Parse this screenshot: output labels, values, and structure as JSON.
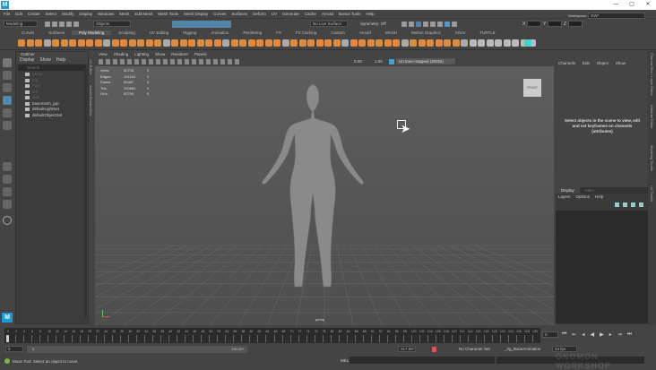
{
  "app": {
    "icon_letter": "M"
  },
  "window_controls": {
    "minimize": "—",
    "maximize": "▢",
    "close": "✕"
  },
  "menu": [
    "File",
    "Edit",
    "Create",
    "Select",
    "Modify",
    "Display",
    "Windows",
    "Mesh",
    "Edit Mesh",
    "Mesh Tools",
    "Mesh Display",
    "Curves",
    "Surfaces",
    "Deform",
    "UV",
    "Generate",
    "Cache",
    "Arnold",
    "Bonus Tools",
    "Help"
  ],
  "status": {
    "mode": "Modeling",
    "select_mode": "Objects",
    "live_surface": "No Live Surface",
    "symmetry": "Symmetry: Off",
    "workspace_label": "Workspace:",
    "workspace": "GW*",
    "x": "X",
    "y": "Y",
    "z": "Z"
  },
  "shelf_tabs": [
    "Curves",
    "Surfaces",
    "Poly Modeling",
    "Sculpting",
    "UV Editing",
    "Rigging",
    "Animation",
    "Rendering",
    "FX",
    "FX Caching",
    "Custom",
    "Arnold",
    "MASH",
    "Motion Graphics",
    "XGen",
    "TURTLE"
  ],
  "shelf_active": "Poly Modeling",
  "outliner": {
    "title": "Outliner",
    "menu": [
      "Display",
      "Show",
      "Help"
    ],
    "search_placeholder": "Search...",
    "items": [
      {
        "name": "persp",
        "dim": true
      },
      {
        "name": "top",
        "dim": true
      },
      {
        "name": "front",
        "dim": true
      },
      {
        "name": "left",
        "dim": true
      },
      {
        "name": "side",
        "dim": true
      },
      {
        "name": "basemesh_grp",
        "dim": false
      },
      {
        "name": "defaultLightSet",
        "dim": false
      },
      {
        "name": "defaultObjectSet",
        "dim": false
      }
    ]
  },
  "side_tabs": {
    "uv": "UV Editor",
    "arnold": "Arnold RenderView"
  },
  "viewport": {
    "menu": [
      "View",
      "Shading",
      "Lighting",
      "Show",
      "Renderer",
      "Panels"
    ],
    "exposure": "0.00",
    "gamma": "1.00",
    "colorspace": "Un tone-mapped (sRGB)",
    "camera": "persp",
    "viewcube": "FRONT",
    "hud": [
      {
        "label": "Verts:",
        "value": "50735",
        "sel": "0"
      },
      {
        "label": "Edges:",
        "value": "101164",
        "sel": "0"
      },
      {
        "label": "Faces:",
        "value": "50487",
        "sel": "0"
      },
      {
        "label": "Tris:",
        "value": "100884",
        "sel": "0"
      },
      {
        "label": "UVs:",
        "value": "52790",
        "sel": "0"
      }
    ]
  },
  "channel_box": {
    "menu": [
      "Channels",
      "Edit",
      "Object",
      "Show"
    ],
    "message": "Select objects in the scene to view, edit and set keyframes on channels (attributes)"
  },
  "layer_editor": {
    "tabs": [
      "Display",
      "Anim"
    ],
    "menu": [
      "Layers",
      "Options",
      "Help"
    ]
  },
  "right_tabs": [
    "Channel Box / Layer Editor",
    "Attribute Editor",
    "Modeling Toolkit",
    "UV Toolkit"
  ],
  "timeline": {
    "start": 0,
    "end": 130,
    "step": 2,
    "current": "0"
  },
  "range": {
    "start": "0",
    "inner_start": "0",
    "inner_end": "130.20*",
    "end": "217.05*",
    "character_set": "No Character Set",
    "anim_layer": "_rig_BaseAnimation",
    "fps": "24 fps"
  },
  "command": {
    "lang": "MEL",
    "help": "Move Tool: Select an object to move."
  },
  "watermark": "GNOMON WORKSHOP",
  "colors": {
    "accent": "#e08a3c",
    "selected": "#5285a6",
    "teal": "#3fd6c8"
  }
}
